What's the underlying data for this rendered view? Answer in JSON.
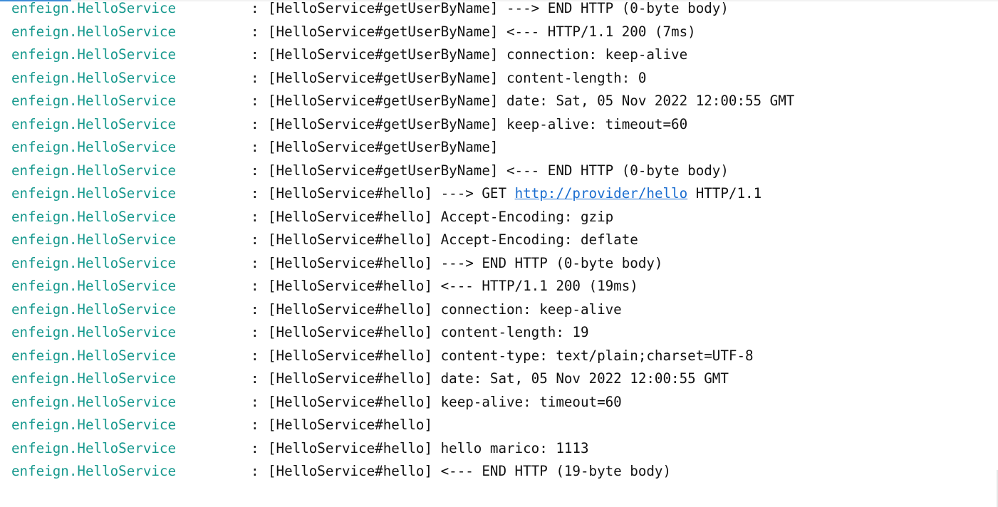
{
  "console": {
    "lines": [
      {
        "logger": "enfeign.HelloService",
        "sep": ":",
        "message": "[HelloService#getUserByName] ---> END HTTP (0-byte body)"
      },
      {
        "logger": "enfeign.HelloService",
        "sep": ":",
        "message": "[HelloService#getUserByName] <--- HTTP/1.1 200 (7ms)"
      },
      {
        "logger": "enfeign.HelloService",
        "sep": ":",
        "message": "[HelloService#getUserByName] connection: keep-alive"
      },
      {
        "logger": "enfeign.HelloService",
        "sep": ":",
        "message": "[HelloService#getUserByName] content-length: 0"
      },
      {
        "logger": "enfeign.HelloService",
        "sep": ":",
        "message": "[HelloService#getUserByName] date: Sat, 05 Nov 2022 12:00:55 GMT"
      },
      {
        "logger": "enfeign.HelloService",
        "sep": ":",
        "message": "[HelloService#getUserByName] keep-alive: timeout=60"
      },
      {
        "logger": "enfeign.HelloService",
        "sep": ":",
        "message": "[HelloService#getUserByName]"
      },
      {
        "logger": "enfeign.HelloService",
        "sep": ":",
        "message": "[HelloService#getUserByName] <--- END HTTP (0-byte body)"
      },
      {
        "logger": "enfeign.HelloService",
        "sep": ":",
        "message_prefix": "[HelloService#hello] ---> GET ",
        "link": "http://provider/hello",
        "message_suffix": " HTTP/1.1"
      },
      {
        "logger": "enfeign.HelloService",
        "sep": ":",
        "message": "[HelloService#hello] Accept-Encoding: gzip"
      },
      {
        "logger": "enfeign.HelloService",
        "sep": ":",
        "message": "[HelloService#hello] Accept-Encoding: deflate"
      },
      {
        "logger": "enfeign.HelloService",
        "sep": ":",
        "message": "[HelloService#hello] ---> END HTTP (0-byte body)"
      },
      {
        "logger": "enfeign.HelloService",
        "sep": ":",
        "message": "[HelloService#hello] <--- HTTP/1.1 200 (19ms)"
      },
      {
        "logger": "enfeign.HelloService",
        "sep": ":",
        "message": "[HelloService#hello] connection: keep-alive"
      },
      {
        "logger": "enfeign.HelloService",
        "sep": ":",
        "message": "[HelloService#hello] content-length: 19"
      },
      {
        "logger": "enfeign.HelloService",
        "sep": ":",
        "message": "[HelloService#hello] content-type: text/plain;charset=UTF-8"
      },
      {
        "logger": "enfeign.HelloService",
        "sep": ":",
        "message": "[HelloService#hello] date: Sat, 05 Nov 2022 12:00:55 GMT"
      },
      {
        "logger": "enfeign.HelloService",
        "sep": ":",
        "message": "[HelloService#hello] keep-alive: timeout=60"
      },
      {
        "logger": "enfeign.HelloService",
        "sep": ":",
        "message": "[HelloService#hello]"
      },
      {
        "logger": "enfeign.HelloService",
        "sep": ":",
        "message": "[HelloService#hello] hello marico: 1113"
      },
      {
        "logger": "enfeign.HelloService",
        "sep": ":",
        "message": "[HelloService#hello] <--- END HTTP (19-byte body)"
      }
    ]
  },
  "colors": {
    "logger": "#17998e",
    "text": "#111111",
    "link": "#1a6dd0",
    "background": "#ffffff"
  }
}
